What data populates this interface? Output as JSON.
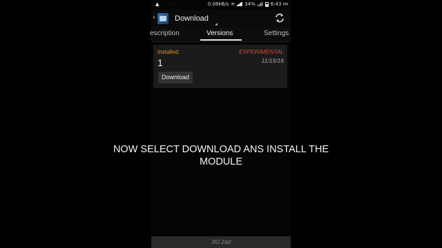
{
  "status_bar": {
    "speed": "0.08kB/s",
    "battery": "34%",
    "time": "6:43",
    "ampm": "PM"
  },
  "app_bar": {
    "title": "Download"
  },
  "tabs": [
    {
      "label": "escription"
    },
    {
      "label": "Versions"
    },
    {
      "label": "Settings"
    }
  ],
  "version_card": {
    "installed_label": "Installed:",
    "version": "1",
    "channel": "EXPERIMENTAL",
    "date": "11/15/16",
    "download_label": "Download"
  },
  "footer": {
    "text": "JIG Zad"
  },
  "caption": {
    "line1": "NOW SELECT DOWNLOAD ANS INSTALL THE",
    "line2": "MODULE"
  },
  "colors": {
    "installed": "#e2932a",
    "experimental": "#e0432f"
  }
}
